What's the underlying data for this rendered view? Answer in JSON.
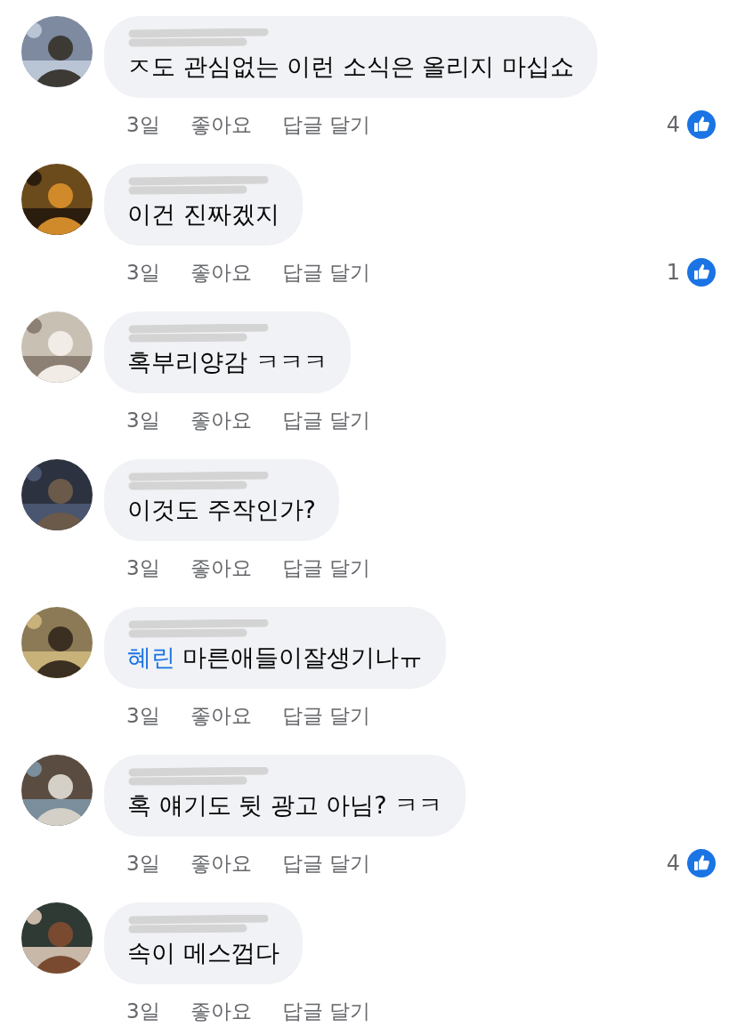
{
  "comments": [
    {
      "text": "ㅈ도 관심없는 이런 소식은 올리지 마십쇼",
      "time": "3일",
      "like": "좋아요",
      "reply": "답글 달기",
      "likes": "4"
    },
    {
      "text": "이건 진짜겠지",
      "time": "3일",
      "like": "좋아요",
      "reply": "답글 달기",
      "likes": "1"
    },
    {
      "text": "혹부리양감 ㅋㅋㅋ",
      "time": "3일",
      "like": "좋아요",
      "reply": "답글 달기"
    },
    {
      "text": "이것도 주작인가?",
      "time": "3일",
      "like": "좋아요",
      "reply": "답글 달기"
    },
    {
      "mention": "혜린",
      "text": "마른애들이잘생기나ㅠ",
      "time": "3일",
      "like": "좋아요",
      "reply": "답글 달기"
    },
    {
      "text": "혹 얘기도 뒷 광고 아님? ㅋㅋ",
      "time": "3일",
      "like": "좋아요",
      "reply": "답글 달기",
      "likes": "4"
    },
    {
      "text": "속이 메스껍다",
      "time": "3일",
      "like": "좋아요",
      "reply": "답글 달기"
    }
  ]
}
